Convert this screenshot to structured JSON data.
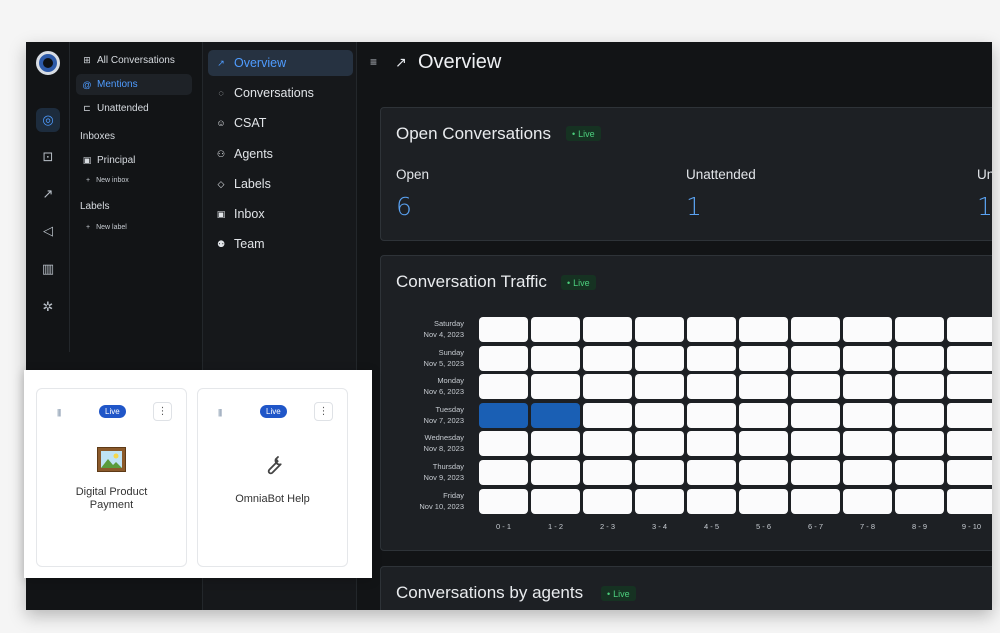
{
  "conv_sidebar": {
    "items": [
      {
        "label": "All Conversations",
        "icon": "inbox-icon"
      },
      {
        "label": "Mentions",
        "icon": "at-icon"
      },
      {
        "label": "Unattended",
        "icon": "clock-icon"
      }
    ],
    "inboxes_heading": "Inboxes",
    "inbox_item": "Principal",
    "new_inbox": "New inbox",
    "labels_heading": "Labels",
    "new_label": "New label"
  },
  "report_nav": {
    "items": [
      {
        "label": "Overview",
        "icon": "chart-icon"
      },
      {
        "label": "Conversations",
        "icon": "chat-icon"
      },
      {
        "label": "CSAT",
        "icon": "smile-icon"
      },
      {
        "label": "Agents",
        "icon": "users-icon"
      },
      {
        "label": "Labels",
        "icon": "tag-icon"
      },
      {
        "label": "Inbox",
        "icon": "inbox-icon"
      },
      {
        "label": "Team",
        "icon": "team-icon"
      }
    ]
  },
  "page": {
    "title": "Overview"
  },
  "open_conversations": {
    "title": "Open Conversations",
    "live": "Live",
    "metrics": [
      {
        "label": "Open",
        "value": "6"
      },
      {
        "label": "Unattended",
        "value": "1"
      },
      {
        "label": "Un",
        "value": "1"
      }
    ]
  },
  "traffic": {
    "title": "Conversation Traffic",
    "live": "Live",
    "days": [
      {
        "day": "Saturday",
        "date": "Nov 4, 2023"
      },
      {
        "day": "Sunday",
        "date": "Nov 5, 2023"
      },
      {
        "day": "Monday",
        "date": "Nov 6, 2023"
      },
      {
        "day": "Tuesday",
        "date": "Nov 7, 2023"
      },
      {
        "day": "Wednesday",
        "date": "Nov 8, 2023"
      },
      {
        "day": "Thursday",
        "date": "Nov 9, 2023"
      },
      {
        "day": "Friday",
        "date": "Nov 10, 2023"
      }
    ],
    "hours": [
      "0 - 1",
      "1 - 2",
      "2 - 3",
      "3 - 4",
      "4 - 5",
      "5 - 6",
      "6 - 7",
      "7 - 8",
      "8 - 9",
      "9 - 10"
    ],
    "highlight": [
      {
        "day": "Tuesday",
        "hour": "0 - 1"
      },
      {
        "day": "Tuesday",
        "hour": "1 - 2"
      }
    ],
    "cell_color": "#fbfbfc",
    "highlight_color": "#1a5fb4"
  },
  "agents_section": {
    "title": "Conversations by agents",
    "live": "Live"
  },
  "bot_cards": [
    {
      "name_line1": "Digital Product",
      "name_line2": "Payment",
      "badge": "Live",
      "icon": "picture-icon"
    },
    {
      "name_line1": "OmniaBot Help",
      "name_line2": "",
      "badge": "Live",
      "icon": "wrench-icon"
    }
  ],
  "colors": {
    "accent": "#4f9cff",
    "live_green": "#4ccf7d",
    "metric_blue": "#5aa2f2"
  }
}
